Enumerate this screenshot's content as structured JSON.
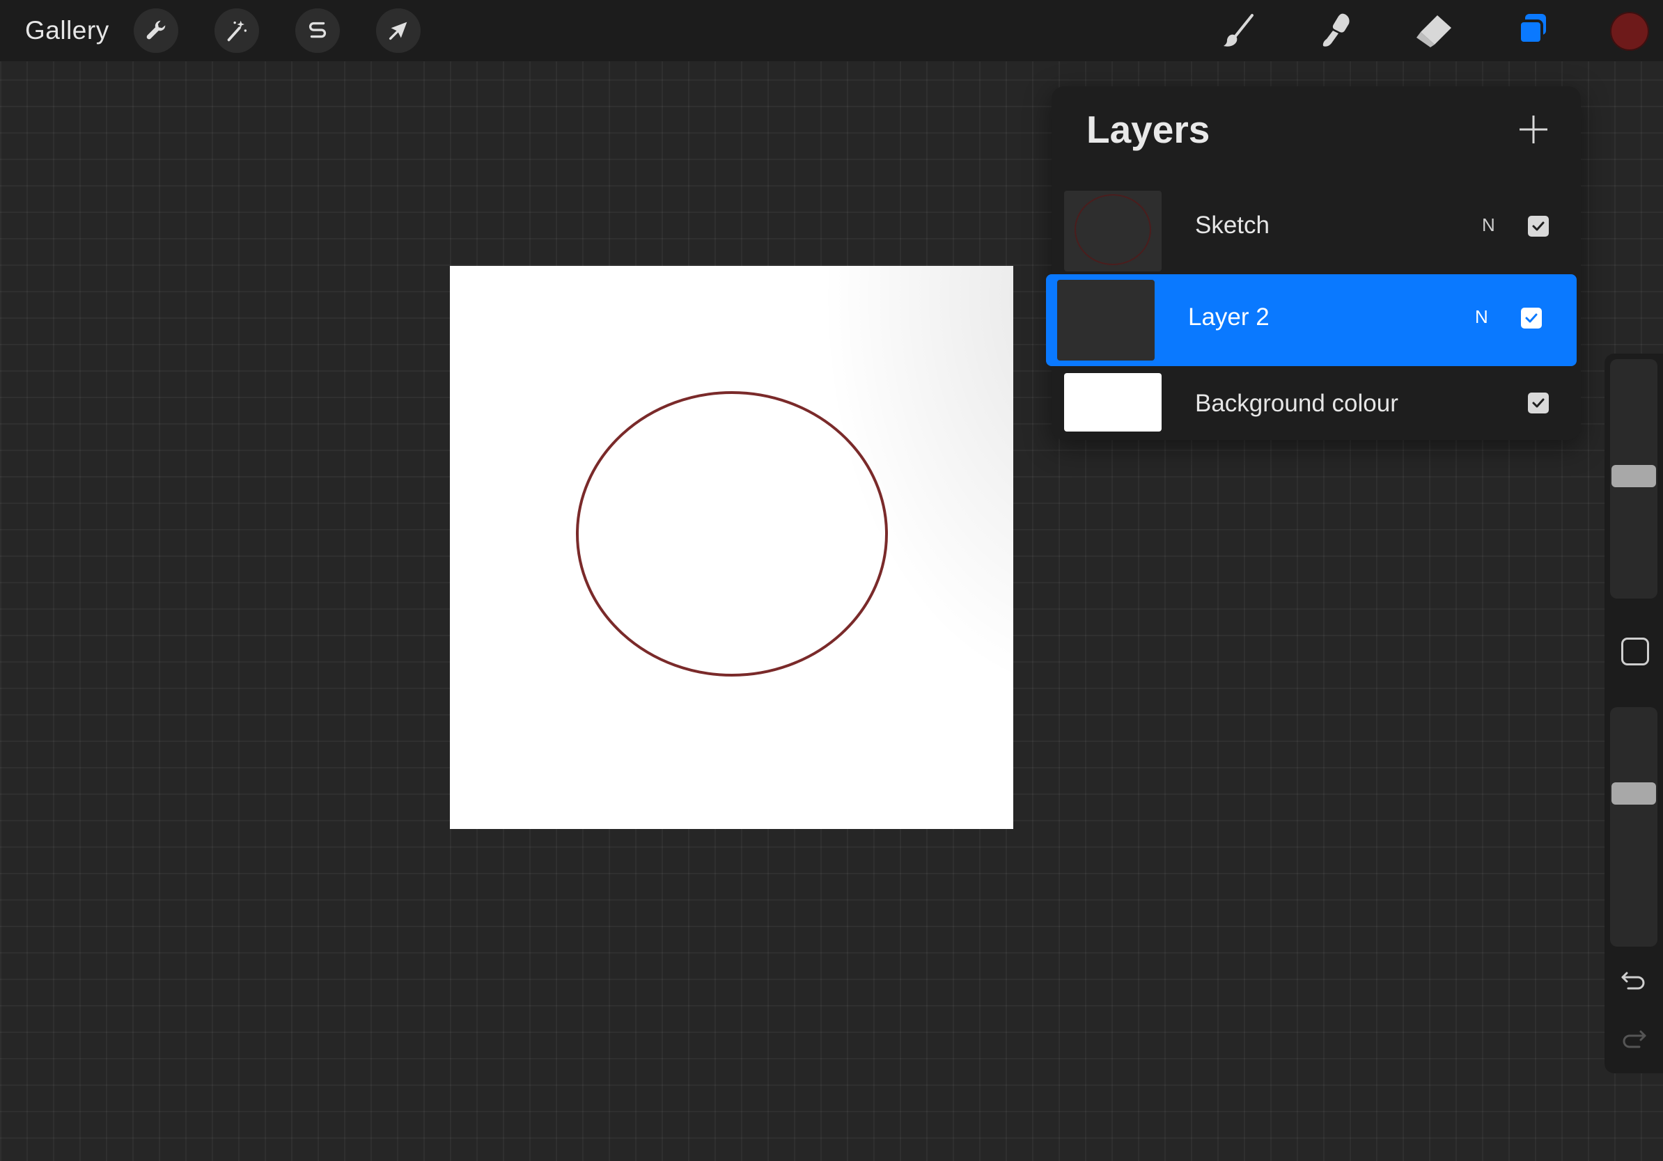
{
  "toolbar": {
    "gallery_label": "Gallery",
    "left_tools": [
      {
        "icon": "wrench-icon",
        "name": "actions"
      },
      {
        "icon": "magic-wand-icon",
        "name": "adjustments"
      },
      {
        "icon": "selection-s-icon",
        "name": "selection"
      },
      {
        "icon": "arrow-cursor-icon",
        "name": "transform"
      }
    ],
    "right_tools": [
      {
        "icon": "brush-icon",
        "name": "paint"
      },
      {
        "icon": "smudge-icon",
        "name": "smudge"
      },
      {
        "icon": "eraser-icon",
        "name": "erase"
      },
      {
        "icon": "layers-icon",
        "name": "layers",
        "active": true
      }
    ],
    "current_color": "#6e1a1a",
    "active_tool_color": "#0a79ff"
  },
  "canvas": {
    "background": "#ffffff",
    "stroke_color": "#7a2a2a"
  },
  "layers_panel": {
    "title": "Layers",
    "add_icon": "plus-icon",
    "layers": [
      {
        "name": "Sketch",
        "mode": "N",
        "visible": true,
        "selected": false
      },
      {
        "name": "Layer 2",
        "mode": "N",
        "visible": true,
        "selected": true
      },
      {
        "name": "Background colour",
        "mode": "",
        "visible": true,
        "selected": false
      }
    ]
  },
  "sidebar": {
    "brush_size_level": 0.55,
    "opacity_level": 0.65,
    "modify_icon": "square-icon",
    "undo_icon": "undo-icon",
    "redo_icon": "redo-icon"
  }
}
